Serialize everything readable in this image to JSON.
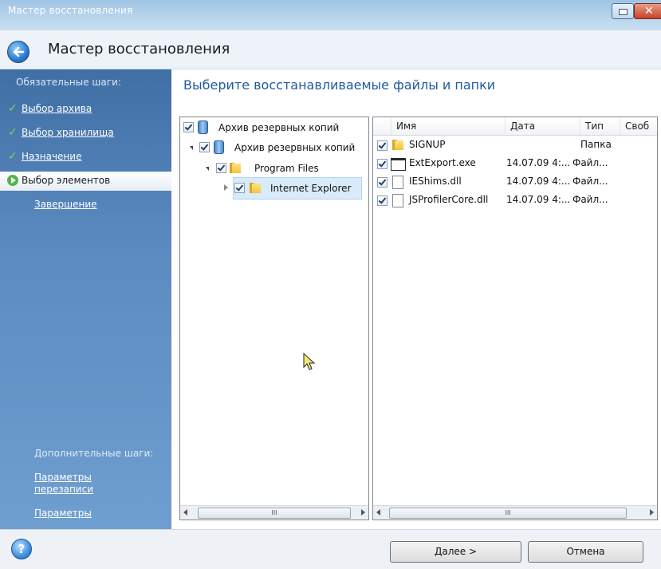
{
  "window": {
    "title": "Мастер восстановления",
    "min_icon": "minimize-icon",
    "close_icon": "close-icon",
    "close_glyph": "✕"
  },
  "header": {
    "title": "Мастер восстановления",
    "back_icon": "back-arrow-icon"
  },
  "sidebar": {
    "required_heading": "Обязательные шаги:",
    "items": [
      {
        "label": "Выбор архива",
        "state": "done"
      },
      {
        "label": "Выбор хранилища",
        "state": "done"
      },
      {
        "label": "Назначение",
        "state": "done"
      },
      {
        "label": "Выбор элементов",
        "state": "active"
      },
      {
        "label": "Завершение",
        "state": "pending"
      }
    ],
    "check_glyph": "✓",
    "optional_heading": "Дополнительные шаги:",
    "optional_links": [
      {
        "label": "Параметры перезаписи"
      },
      {
        "label": "Параметры"
      }
    ]
  },
  "main": {
    "title": "Выберите восстанавливаемые файлы и папки",
    "tree": [
      {
        "label": "Архив резервных копий",
        "icon": "archive-icon",
        "checked": true
      },
      {
        "label": "Архив резервных копий",
        "icon": "archive-icon",
        "checked": true,
        "expanded": true
      },
      {
        "label": "Program Files",
        "icon": "folder-icon",
        "checked": true,
        "expanded": true
      },
      {
        "label": "Internet Explorer",
        "icon": "folder-icon",
        "checked": true,
        "selected": true
      }
    ],
    "list_columns": [
      "Имя",
      "Дата",
      "Тип",
      "Своб"
    ],
    "list_rows": [
      {
        "name": "SIGNUP",
        "date": "",
        "type": "Папка",
        "icon": "folder-icon",
        "checked": true
      },
      {
        "name": "ExtExport.exe",
        "date": "14.07.09 4:...",
        "type": "Файл...",
        "icon": "executable-icon",
        "checked": true
      },
      {
        "name": "IEShims.dll",
        "date": "14.07.09 4:...",
        "type": "Файл...",
        "icon": "file-icon",
        "checked": true
      },
      {
        "name": "JSProfilerCore.dll",
        "date": "14.07.09 4:...",
        "type": "Файл...",
        "icon": "file-icon",
        "checked": true
      }
    ],
    "scroll_grip": "III"
  },
  "footer": {
    "help_icon": "help-icon",
    "help_glyph": "?",
    "next_label": "Далее >",
    "cancel_label": "Отмена"
  },
  "colors": {
    "accent": "#1f5a9f",
    "sidebar": "#5b8bc0",
    "check": "#7bdc3c"
  }
}
